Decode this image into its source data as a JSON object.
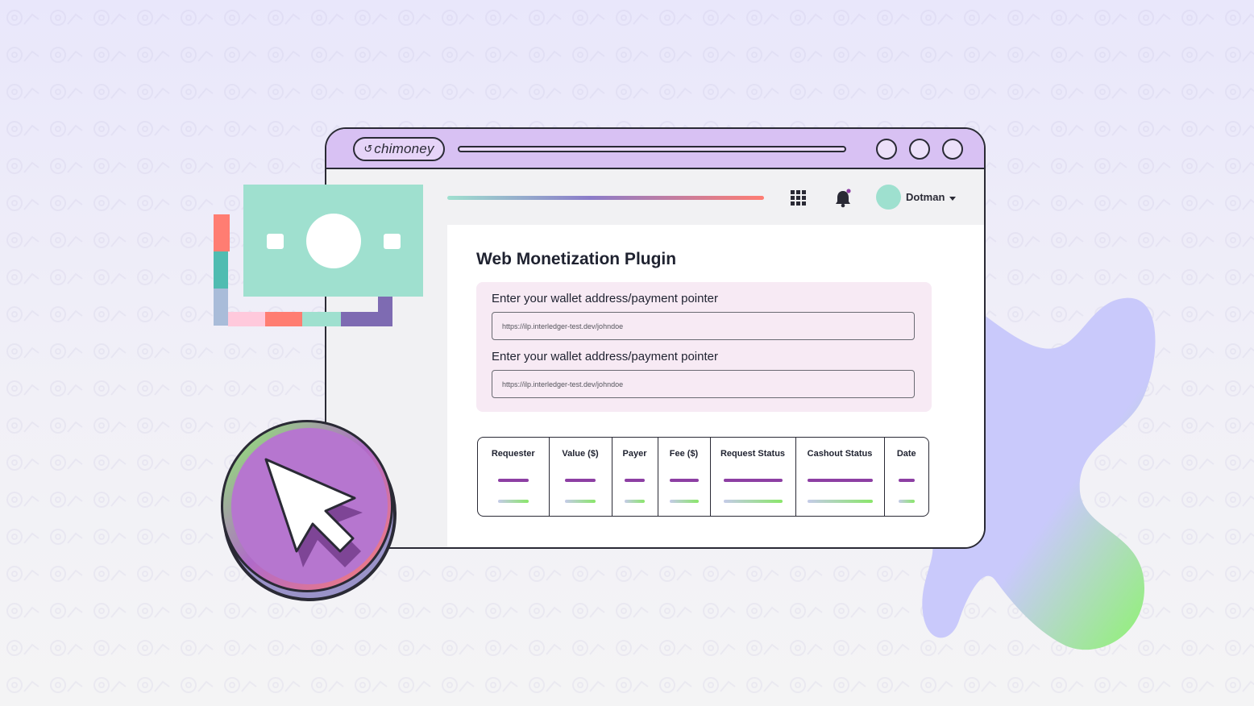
{
  "brand": {
    "logo_text": "chimoney"
  },
  "header": {
    "user_name": "Dotman"
  },
  "main": {
    "title": "Web Monetization Plugin",
    "fields": [
      {
        "label": "Enter your wallet address/payment pointer",
        "value": "https://ilp.interledger-test.dev/johndoe"
      },
      {
        "label": "Enter your wallet address/payment pointer",
        "value": "https://ilp.interledger-test.dev/johndoe"
      }
    ],
    "table": {
      "columns": [
        "Requester",
        "Value ($)",
        "Payer",
        "Fee ($)",
        "Request Status",
        "Cashout Status",
        "Date"
      ]
    }
  },
  "colors": {
    "titlebar": "#d8c1f3",
    "accent_purple": "#8d3fa3",
    "accent_green": "#8ae66a",
    "mint": "#9ee0cf",
    "form_bg": "#f7eaf4"
  },
  "icons": [
    "apps-grid-icon",
    "notification-bell-icon",
    "caret-down-icon",
    "cursor-arrow-icon",
    "money-bill-icon"
  ]
}
